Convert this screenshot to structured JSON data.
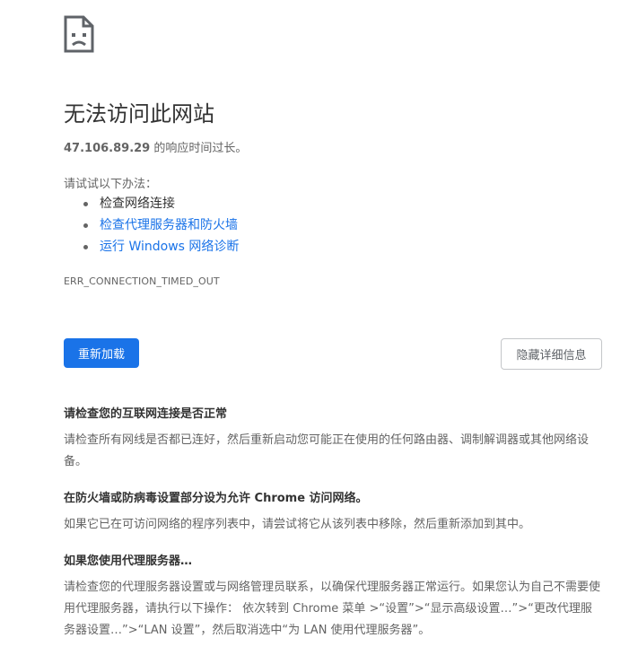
{
  "icon": "sad-page-icon",
  "title": "无法访问此网站",
  "summary": {
    "host": "47.106.89.29",
    "message": " 的响应时间过长。"
  },
  "suggestions": {
    "heading": "请试试以下办法：",
    "items": [
      {
        "label": "检查网络连接",
        "link": false
      },
      {
        "label": "检查代理服务器和防火墙",
        "link": true
      },
      {
        "label": "运行 Windows 网络诊断",
        "link": true
      }
    ]
  },
  "error_code": "ERR_CONNECTION_TIMED_OUT",
  "buttons": {
    "reload": "重新加载",
    "details": "隐藏详细信息"
  },
  "details": [
    {
      "heading": "请检查您的互联网连接是否正常",
      "body": "请检查所有网线是否都已连好，然后重新启动您可能正在使用的任何路由器、调制解调器或其他网络设备。"
    },
    {
      "heading": "在防火墙或防病毒设置部分设为允许 Chrome 访问网络。",
      "body": "如果它已在可访问网络的程序列表中，请尝试将它从该列表中移除，然后重新添加到其中。"
    },
    {
      "heading": "如果您使用代理服务器…",
      "body": "请检查您的代理服务器设置或与网络管理员联系，以确保代理服务器正常运行。如果您认为自己不需要使用代理服务器，请执行以下操作： 依次转到 Chrome 菜单 >“设置”>“显示高级设置…”>“更改代理服务器设置…”>“LAN 设置”，然后取消选中“为 LAN 使用代理服务器”。"
    }
  ],
  "colors": {
    "accent": "#1a73e8",
    "heading": "#333333",
    "text": "#646464"
  }
}
